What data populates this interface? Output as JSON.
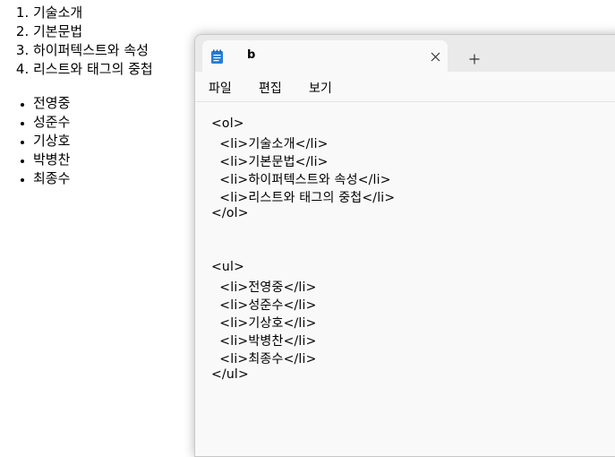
{
  "browser": {
    "ordered_list": [
      "기술소개",
      "기본문법",
      "하이퍼텍스트와 속성",
      "리스트와 태그의 중첩"
    ],
    "unordered_list": [
      "전영중",
      "성준수",
      "기상호",
      "박병찬",
      "최종수"
    ]
  },
  "notepad": {
    "tab": {
      "title": "b",
      "icon": "notepad-icon"
    },
    "close_icon": "close-icon",
    "new_tab_icon": "plus-icon",
    "menu": {
      "file": "파일",
      "edit": "편집",
      "view": "보기"
    },
    "code_lines": [
      "<ol>",
      "  <li>기술소개</li>",
      "  <li>기본문법</li>",
      "  <li>하이퍼텍스트와 속성</li>",
      "  <li>리스트와 태그의 중첩</li>",
      "</ol>",
      "",
      "",
      "<ul>",
      "  <li>전영중</li>",
      "  <li>성준수</li>",
      "  <li>기상호</li>",
      "  <li>박병찬</li>",
      "  <li>최종수</li>",
      "</ul>"
    ]
  },
  "colors": {
    "notepad_icon": "#2b7bd1",
    "titlebar": "#eaeaea",
    "editor_bg": "#f9f9f9"
  }
}
